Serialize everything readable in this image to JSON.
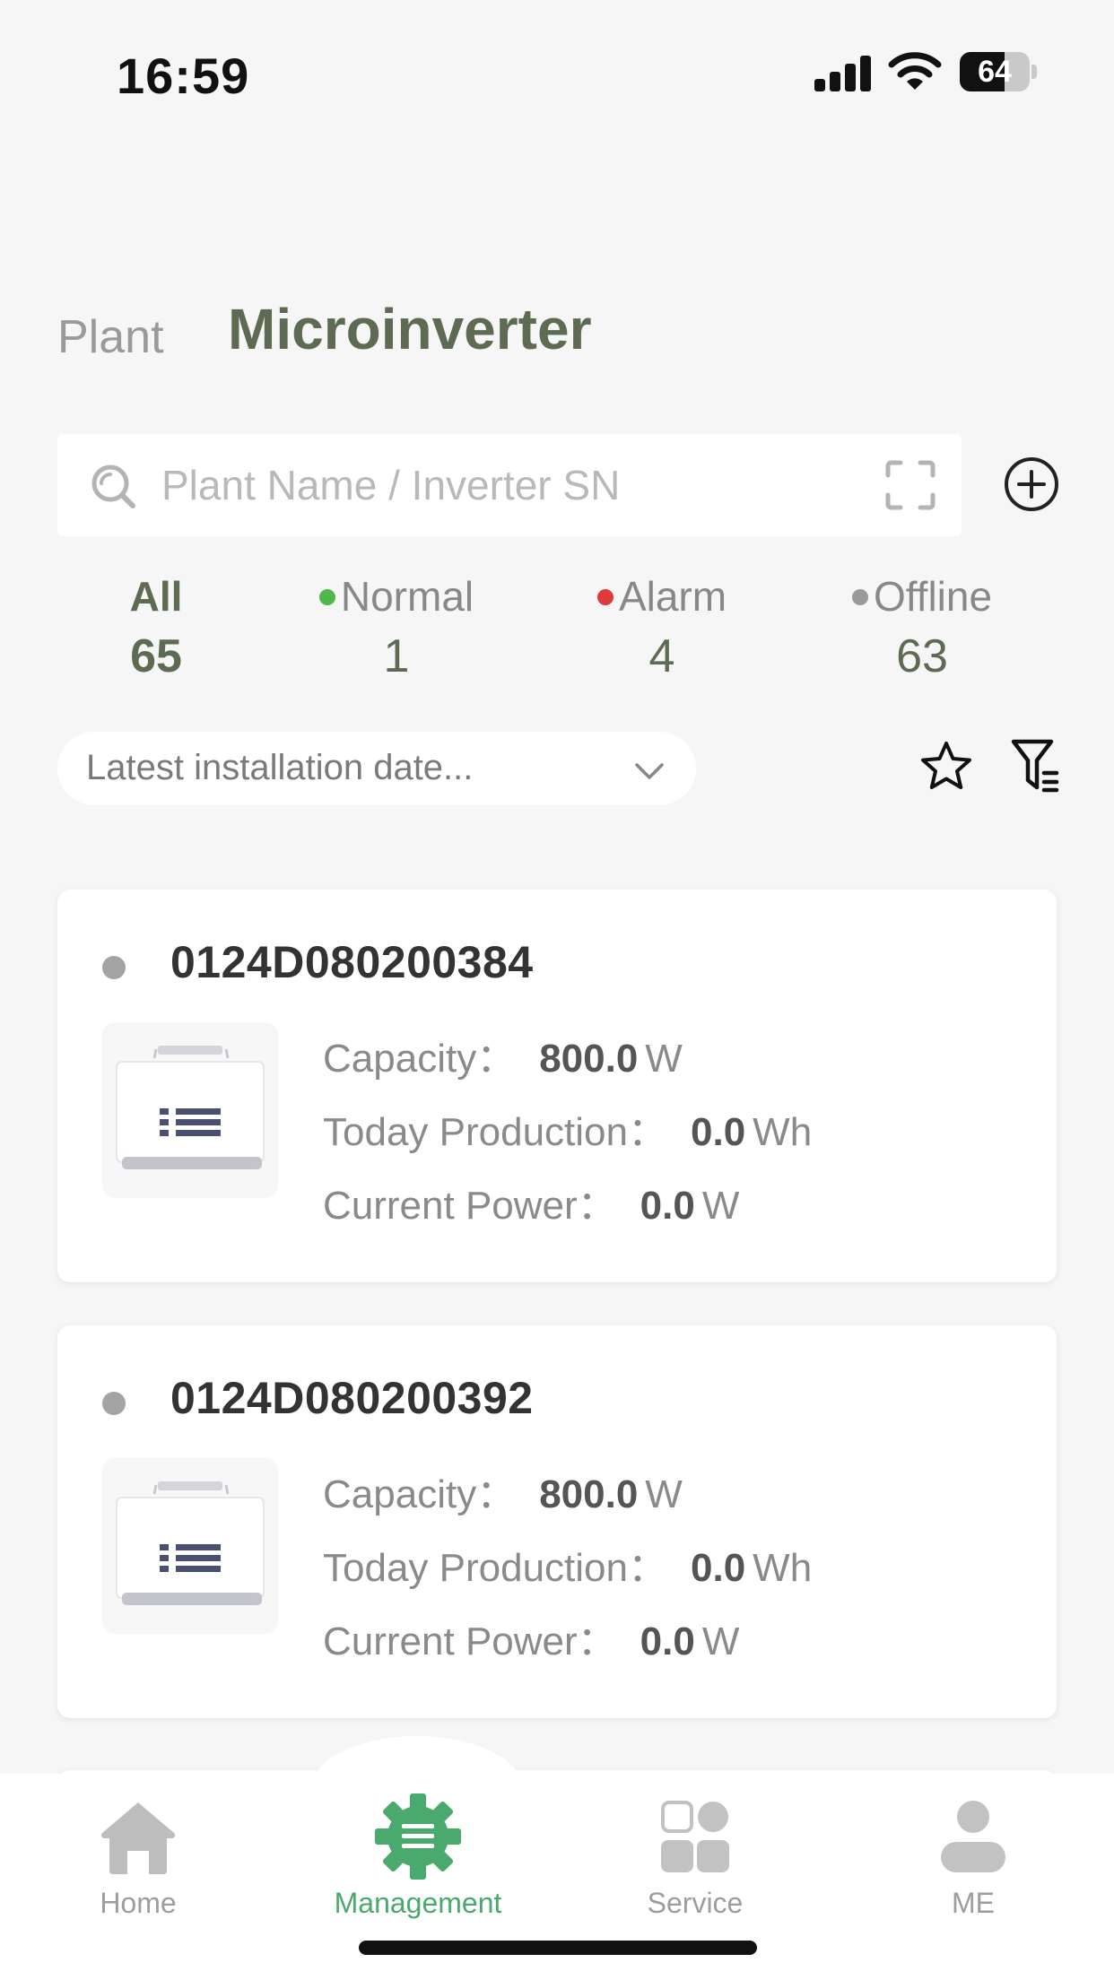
{
  "status_bar": {
    "time": "16:59",
    "battery_percent": 64,
    "battery_label": "64",
    "icons": [
      "signal-icon",
      "wifi-icon",
      "battery-icon"
    ]
  },
  "tabs": [
    {
      "label": "Plant",
      "active": false
    },
    {
      "label": "Microinverter",
      "active": true
    }
  ],
  "search": {
    "placeholder": "Plant Name / Inverter SN",
    "value": ""
  },
  "status_filters": [
    {
      "label": "All",
      "count": "65",
      "dot_color": null,
      "active": true
    },
    {
      "label": "Normal",
      "count": "1",
      "dot_color": "#4fb849",
      "active": false
    },
    {
      "label": "Alarm",
      "count": "4",
      "dot_color": "#e0393a",
      "active": false
    },
    {
      "label": "Offline",
      "count": "63",
      "dot_color": "#9a9a9a",
      "active": false
    }
  ],
  "sort": {
    "selected": "Latest installation date..."
  },
  "labels": {
    "capacity": "Capacity：",
    "today_production": "Today Production：",
    "current_power": "Current Power："
  },
  "devices": [
    {
      "sn": "0124D080200384",
      "status_color": "#a3a3a3",
      "capacity": "800.0",
      "capacity_unit": "W",
      "today_production": "0.0",
      "today_production_unit": "Wh",
      "current_power": "0.0",
      "current_power_unit": "W"
    },
    {
      "sn": "0124D080200392",
      "status_color": "#a3a3a3",
      "capacity": "800.0",
      "capacity_unit": "W",
      "today_production": "0.0",
      "today_production_unit": "Wh",
      "current_power": "0.0",
      "current_power_unit": "W"
    }
  ],
  "bottom_nav": [
    {
      "label": "Home",
      "icon": "home-icon",
      "active": false
    },
    {
      "label": "Management",
      "icon": "management-gear-icon",
      "active": true
    },
    {
      "label": "Service",
      "icon": "service-grid-icon",
      "active": false
    },
    {
      "label": "ME",
      "icon": "person-icon",
      "active": false
    }
  ],
  "colors": {
    "accent_green": "#4aa96c",
    "title_olive": "#5d6b53",
    "background": "#f6f6f6"
  }
}
